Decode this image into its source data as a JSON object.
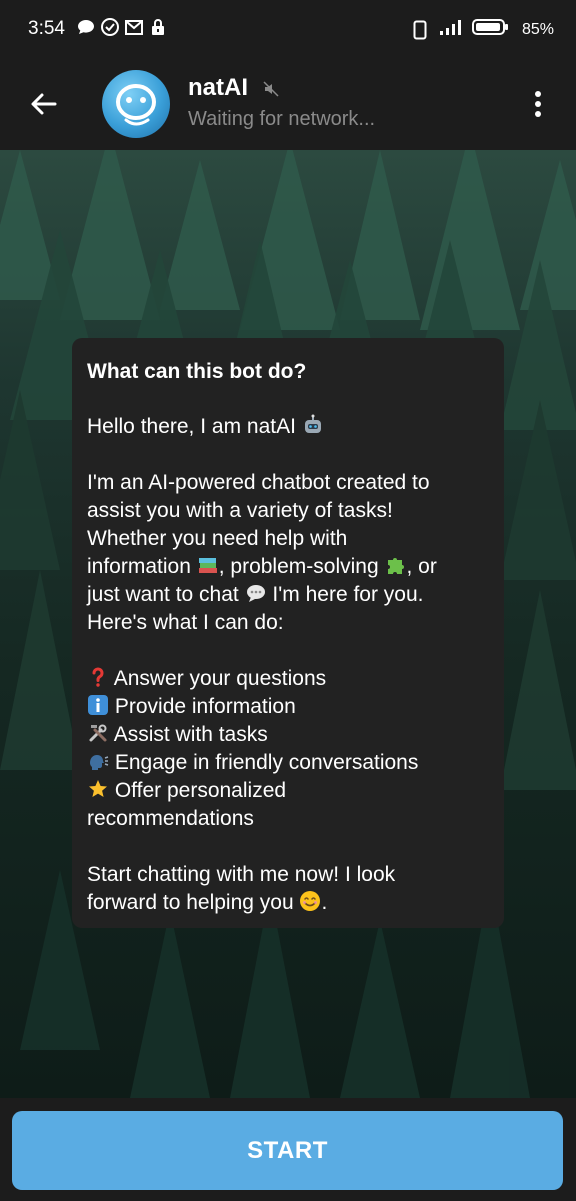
{
  "status_bar": {
    "time": "3:54",
    "battery_percent": "85%",
    "icons": [
      "chat-bubble-icon",
      "check-circle-icon",
      "mail-icon",
      "lock-icon",
      "phone-icon",
      "signal-icon",
      "battery-icon"
    ]
  },
  "header": {
    "back_icon": "arrow-left-icon",
    "title": "natAI",
    "status": "Waiting for network...",
    "muted_icon": "muted-speaker-icon",
    "menu_icon": "more-vert-icon"
  },
  "bot_info": {
    "title": "What can this bot do?",
    "greeting": "Hello there, I am natAI",
    "intro_line1": "I'm an AI-powered chatbot created to",
    "intro_line2": "assist you with a variety of tasks!",
    "intro_line3": "Whether you need help with",
    "intro_line4_a": "information",
    "intro_line4_b": ", problem-solving",
    "intro_line4_c": ", or",
    "intro_line5_a": "just want to chat",
    "intro_line5_b": " I'm here for you.",
    "intro_line6": "Here's what I can do:",
    "features": [
      "Answer your questions",
      "Provide information",
      "Assist with tasks",
      "Engage in friendly conversations",
      "Offer personalized"
    ],
    "features_continuation": "recommendations",
    "closing_line1": "Start chatting with me now! I look",
    "closing_line2": "forward to helping you",
    "closing_end": "."
  },
  "start_button": {
    "label": "START"
  },
  "colors": {
    "bar_bg": "#1c1c1c",
    "card_bg": "#222222",
    "accent": "#5aace3",
    "status_text": "#8a8a8a"
  }
}
